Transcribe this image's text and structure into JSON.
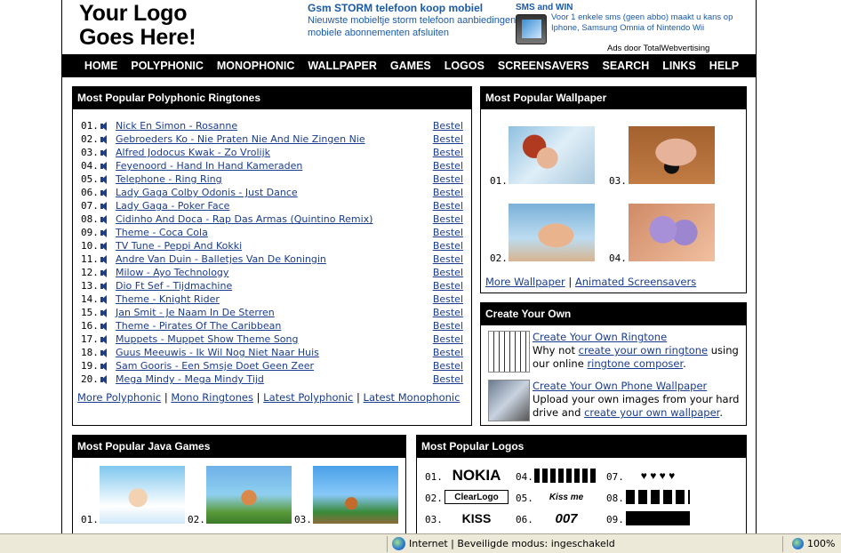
{
  "header": {
    "logo_text": "Your Logo\nGoes Here!",
    "ad1": {
      "title": "Gsm STORM telefoon koop mobiel",
      "desc": "Nieuwste mobieltje storm telefoon aanbiedingen mobiele abonnementen afsluiten"
    },
    "ad2": {
      "title": "SMS and WIN",
      "desc": "Voor 1 enkele sms (geen abbo) maakt u kans op Iphone, Samsung Omnia of Nintendo Wii"
    },
    "ads_by": "Ads door TotalWebvertising"
  },
  "nav": [
    "HOME",
    "POLYPHONIC",
    "MONOPHONIC",
    "WALLPAPER",
    "GAMES",
    "LOGOS",
    "SCREENSAVERS",
    "SEARCH",
    "LINKS",
    "HELP"
  ],
  "polyphonic": {
    "title": "Most Popular Polyphonic Ringtones",
    "buy_label": "Bestel",
    "items": [
      {
        "num": "01.",
        "title": "Nick En Simon - Rosanne"
      },
      {
        "num": "02.",
        "title": "Gebroeders Ko - Nie Praten Nie And Nie Zingen Nie"
      },
      {
        "num": "03.",
        "title": "Alfred Jodocus Kwak - Zo Vrolijk"
      },
      {
        "num": "04.",
        "title": "Feyenoord - Hand In Hand Kameraden"
      },
      {
        "num": "05.",
        "title": "Telephone - Ring Ring"
      },
      {
        "num": "06.",
        "title": "Lady Gaga Colby Odonis - Just Dance"
      },
      {
        "num": "07.",
        "title": "Lady Gaga - Poker Face"
      },
      {
        "num": "08.",
        "title": "Cidinho And Doca - Rap Das Armas (Quintino Remix)"
      },
      {
        "num": "09.",
        "title": "Theme - Coca Cola"
      },
      {
        "num": "10.",
        "title": "TV Tune - Peppi And Kokki"
      },
      {
        "num": "11.",
        "title": "Andre Van Duin - Balletjes Van De Koningin"
      },
      {
        "num": "12.",
        "title": "Milow - Ayo Technology"
      },
      {
        "num": "13.",
        "title": "Dio Ft Sef - Tijdmachine"
      },
      {
        "num": "14.",
        "title": "Theme - Knight Rider"
      },
      {
        "num": "15.",
        "title": "Jan Smit - Je Naam In De Sterren"
      },
      {
        "num": "16.",
        "title": "Theme - Pirates Of The Caribbean"
      },
      {
        "num": "17.",
        "title": "Muppets - Muppet Show Theme Song"
      },
      {
        "num": "18.",
        "title": "Guus Meeuwis - Ik Wil Nog Niet Naar Huis"
      },
      {
        "num": "19.",
        "title": "Sam Gooris - Een Smsje Doet Geen Zeer"
      },
      {
        "num": "20.",
        "title": "Mega Mindy - Mega Mindy Tijd"
      }
    ],
    "footer_links": [
      "More Polyphonic",
      "Mono Ringtones",
      "Latest Polyphonic",
      "Latest Monophonic"
    ]
  },
  "wallpaper": {
    "title": "Most Popular Wallpaper",
    "nums": [
      "01.",
      "03.",
      "02.",
      "04."
    ],
    "footer_links": [
      "More Wallpaper",
      "Animated Screensavers"
    ]
  },
  "create": {
    "title": "Create Your Own",
    "ringtone": {
      "heading": "Create Your Own Ringtone",
      "t1": "Why not ",
      "l1": "create your own ringtone",
      "t2": " using our online ",
      "l2": "ringtone composer",
      "t3": "."
    },
    "wallpaper": {
      "heading": "Create Your Own Phone Wallpaper",
      "t1": "Upload your own images from your hard drive and ",
      "l1": "create your own wallpaper",
      "t2": "."
    }
  },
  "games": {
    "title": "Most Popular Java Games",
    "nums": [
      "01.",
      "02.",
      "03."
    ]
  },
  "logos": {
    "title": "Most Popular Logos",
    "nums": [
      "01.",
      "04.",
      "07.",
      "02.",
      "05.",
      "08.",
      "03.",
      "06.",
      "09."
    ],
    "texts": {
      "nokia": "NOKIA",
      "clearlogo": "ClearLogo",
      "kiss": "KISS",
      "kissme": "Kiss me",
      "bond": "007"
    }
  },
  "statusbar": {
    "zone": "Internet | Beveiligde modus: ingeschakeld",
    "zoom": "100%"
  }
}
